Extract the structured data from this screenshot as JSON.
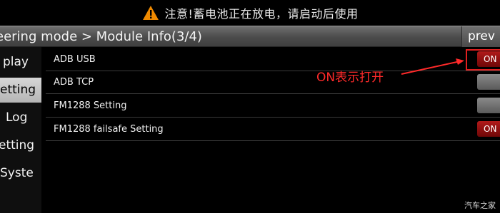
{
  "warning": {
    "text": "注意!蓄电池正在放电，请启动后使用",
    "icon": "warning-icon"
  },
  "header": {
    "title": "eering mode > Module Info(3/4)",
    "prev_label": "prev"
  },
  "sidebar": {
    "items": [
      {
        "label": "play",
        "active": false
      },
      {
        "label": "etting",
        "active": true
      },
      {
        "label": "Log",
        "active": false
      },
      {
        "label": "etting",
        "active": false
      },
      {
        "label": "Syste",
        "active": false
      }
    ]
  },
  "settings": {
    "rows": [
      {
        "label": "ADB USB",
        "state": "ON"
      },
      {
        "label": "ADB TCP",
        "state": ""
      },
      {
        "label": "FM1288 Setting",
        "state": ""
      },
      {
        "label": "FM1288 failsafe Setting",
        "state": "ON"
      }
    ]
  },
  "annotation": {
    "text": "ON表示打开",
    "color": "#ff2a2a"
  },
  "watermark": {
    "text": "汽车之家"
  },
  "colors": {
    "toggle_on": "#9a1010",
    "toggle_off": "#7a7a7a",
    "active_tab": "#c8c8c8"
  }
}
